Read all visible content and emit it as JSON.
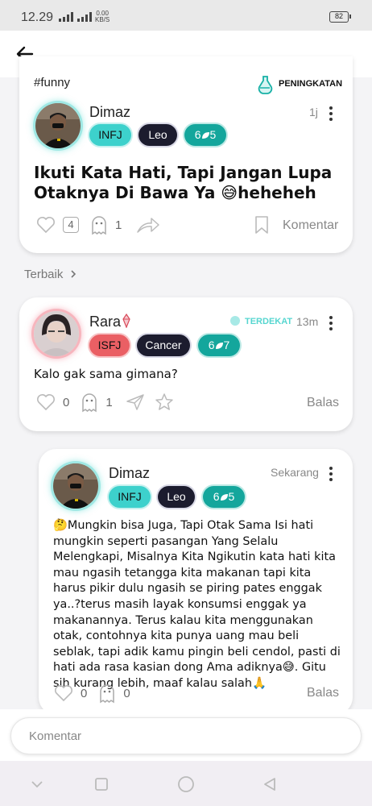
{
  "status_bar": {
    "time": "12.29",
    "net_speed_value": "0.00",
    "net_speed_unit": "KB/S",
    "battery": "82"
  },
  "post": {
    "hashtag": "#funny",
    "boost_label": "PENINGKATAN",
    "author": "Dimaz",
    "time": "1j",
    "chips": {
      "mbti": "INFJ",
      "zodiac": "Leo",
      "level_left": "6",
      "level_right": "5"
    },
    "title": "Ikuti Kata Hati, Tapi Jangan Lupa Otaknya Di Bawa Ya 😅heheheh",
    "likes": "4",
    "ghosts": "1",
    "comment_label": "Komentar"
  },
  "best_label": "Terbaik",
  "comments": [
    {
      "author": "Rara",
      "closest_label": "TERDEKAT",
      "time": "13m",
      "chips": {
        "mbti": "ISFJ",
        "zodiac": "Cancer",
        "level_left": "6",
        "level_right": "7"
      },
      "text": "Kalo gak sama gimana?",
      "likes": "0",
      "ghosts": "1",
      "reply_label": "Balas"
    },
    {
      "author": "Dimaz",
      "time": "Sekarang",
      "chips": {
        "mbti": "INFJ",
        "zodiac": "Leo",
        "level_left": "6",
        "level_right": "5"
      },
      "text": "🤔Mungkin bisa Juga, Tapi Otak Sama Isi hati mungkin seperti pasangan Yang Selalu Melengkapi, Misalnya Kita Ngikutin kata hati kita mau ngasih tetangga kita makanan tapi kita harus pikir dulu ngasih se piring pates enggak ya..?terus masih layak konsumsi enggak ya makanannya. Terus kalau kita menggunakan otak, contohnya kita punya uang mau beli seblak, tapi adik kamu pingin beli cendol, pasti di hati ada rasa kasian dong Ama adiknya😅. Gitu sih kurang lebih, maaf kalau salah🙏",
      "likes": "0",
      "ghosts": "0",
      "reply_label": "Balas"
    }
  ],
  "comment_input": {
    "placeholder": "Komentar"
  },
  "icons": {
    "back": "arrow-left-icon",
    "boost": "potion-icon",
    "heart": "heart-icon",
    "ghost": "ghost-icon",
    "share": "share-icon",
    "bookmark": "bookmark-icon",
    "send": "send-icon",
    "star": "star-icon",
    "more": "more-vertical-icon",
    "crystal": "crystal-icon"
  },
  "colors": {
    "mbti_teal": "#3dd1cc",
    "level_teal": "#14a69c",
    "zodiac_dark": "#1c1c2e",
    "isfj_red": "#ea5f64",
    "closest_teal": "#56d6d0"
  }
}
